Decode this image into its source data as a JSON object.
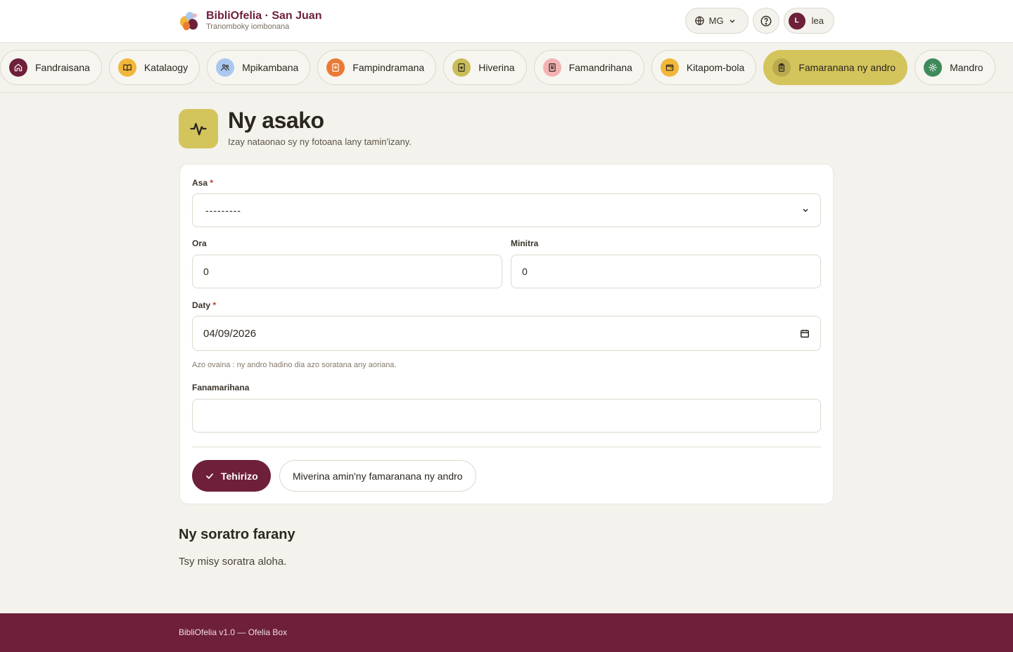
{
  "brand": {
    "title": "BibliOfelia · San Juan",
    "subtitle": "Tranomboky iombonana"
  },
  "header": {
    "language": "MG",
    "user_initial": "L",
    "user_name": "lea"
  },
  "nav": [
    {
      "label": "Fandraisana",
      "icon": "home-icon",
      "color": "#6e1f39",
      "active": false
    },
    {
      "label": "Katalaogy",
      "icon": "book-open-icon",
      "color": "#f0b73a",
      "active": false
    },
    {
      "label": "Mpikambana",
      "icon": "users-icon",
      "color": "#a9c8ef",
      "active": false
    },
    {
      "label": "Fampindramana",
      "icon": "book-download-icon",
      "color": "#ea7a35",
      "active": false
    },
    {
      "label": "Hiverina",
      "icon": "book-return-icon",
      "color": "#c9bd58",
      "active": false
    },
    {
      "label": "Famandrihana",
      "icon": "bookmark-icon",
      "color": "#f3b3b3",
      "active": false
    },
    {
      "label": "Kitapom-bola",
      "icon": "wallet-icon",
      "color": "#f0b73a",
      "active": false
    },
    {
      "label": "Famaranana ny andro",
      "icon": "clipboard-icon",
      "color": "#b9ab4d",
      "active": true
    },
    {
      "label": "Mandro",
      "icon": "gear-icon",
      "color": "#3f8a5b",
      "active": false
    }
  ],
  "page": {
    "title": "Ny asako",
    "subtitle": "Izay nataonao sy ny fotoana lany tamin'izany.",
    "icon": "activity-icon"
  },
  "form": {
    "activity": {
      "label": "Asa",
      "required_mark": "*",
      "value": "---------"
    },
    "hours": {
      "label": "Ora",
      "value": "0"
    },
    "minutes": {
      "label": "Minitra",
      "value": "0"
    },
    "date": {
      "label": "Daty",
      "required_mark": "*",
      "value": "04/09/2026",
      "hint": "Azo ovaina : ny andro hadino dia azo soratana any aoriana."
    },
    "notes": {
      "label": "Fanamarihana",
      "value": ""
    },
    "save_label": "Tehirizo",
    "back_label": "Miverina amin'ny famaranana ny andro"
  },
  "recent": {
    "title": "Ny soratro farany",
    "empty": "Tsy misy soratra aloha."
  },
  "footer": {
    "text": "BibliOfelia v1.0 — Ofelia Box"
  }
}
